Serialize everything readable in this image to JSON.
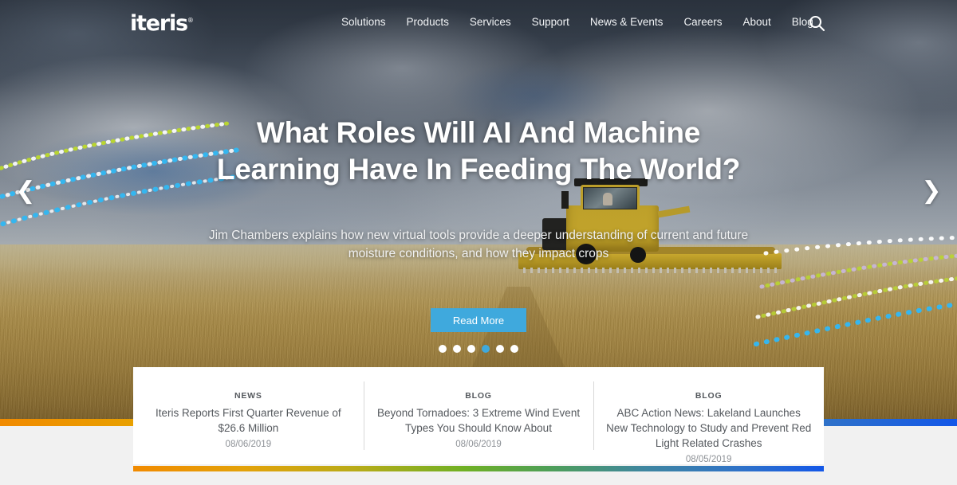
{
  "brand": {
    "name": "iteris",
    "trademark": "®"
  },
  "nav": {
    "items": [
      {
        "label": "Solutions"
      },
      {
        "label": "Products"
      },
      {
        "label": "Services"
      },
      {
        "label": "Support"
      },
      {
        "label": "News & Events"
      },
      {
        "label": "Careers"
      },
      {
        "label": "About"
      },
      {
        "label": "Blog"
      }
    ],
    "search_icon": "search-icon"
  },
  "hero": {
    "title": "What Roles Will AI And Machine Learning Have In Feeding The World?",
    "subtitle": "Jim Chambers explains how new virtual tools provide a deeper understanding of current and future moisture conditions, and how they impact crops",
    "cta_label": "Read More",
    "prev_icon": "chevron-left-icon",
    "next_icon": "chevron-right-icon",
    "slides_total": 6,
    "slide_active": 4,
    "accent_color": "#3fa9dd"
  },
  "cards": [
    {
      "tag": "NEWS",
      "title": "Iteris Reports First Quarter Revenue of $26.6 Million",
      "date": "08/06/2019"
    },
    {
      "tag": "BLOG",
      "title": "Beyond Tornadoes: 3 Extreme Wind Event Types You Should Know About",
      "date": "08/06/2019"
    },
    {
      "tag": "BLOG",
      "title": "ABC Action News: Lakeland Launches New Technology to Study and Prevent Red Light Related Crashes",
      "date": "08/05/2019"
    }
  ],
  "strip": {
    "from_color": "#f18a00",
    "mid_color": "#6fb024",
    "to_color": "#1357e8"
  }
}
